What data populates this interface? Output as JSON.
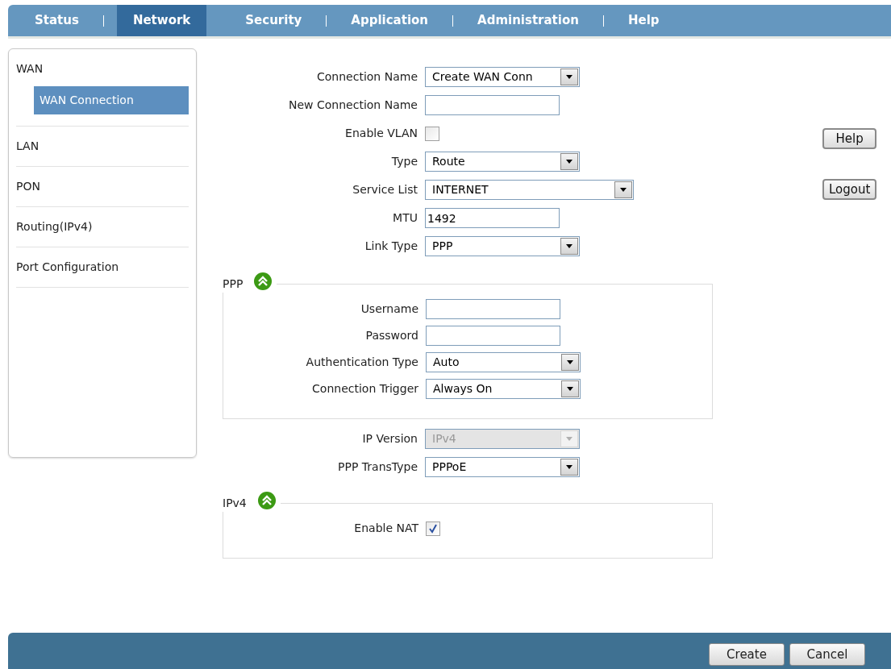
{
  "nav": {
    "tabs": [
      {
        "label": "Status",
        "selected": false
      },
      {
        "label": "Network",
        "selected": true
      },
      {
        "label": "Security",
        "selected": false
      },
      {
        "label": "Application",
        "selected": false
      },
      {
        "label": "Administration",
        "selected": false
      },
      {
        "label": "Help",
        "selected": false
      }
    ]
  },
  "sidebar": {
    "items": [
      {
        "label": "WAN",
        "selected": false,
        "children": [
          {
            "label": "WAN Connection",
            "selected": true
          }
        ]
      },
      {
        "label": "LAN",
        "selected": false
      },
      {
        "label": "PON",
        "selected": false
      },
      {
        "label": "Routing(IPv4)",
        "selected": false
      },
      {
        "label": "Port Configuration",
        "selected": false
      }
    ]
  },
  "form": {
    "items": [
      {
        "kind": "select",
        "label": "Connection Name",
        "value": "Create WAN Conn",
        "disabled": false
      },
      {
        "kind": "text",
        "label": "New Connection Name"
      },
      {
        "kind": "checkbox",
        "label": "Enable VLAN",
        "checked": false
      },
      {
        "kind": "select",
        "label": "Type",
        "value": "Route",
        "disabled": false
      },
      {
        "kind": "select",
        "label": "Service List",
        "value": "INTERNET",
        "disabled": false
      },
      {
        "kind": "text",
        "label": "MTU",
        "value": "1492"
      },
      {
        "kind": "select",
        "label": "Link Type",
        "value": "PPP",
        "disabled": false
      },
      {
        "kind": "section",
        "title": "PPP",
        "expanded": true,
        "fields": [
          {
            "kind": "text",
            "label": "Username"
          },
          {
            "kind": "text",
            "label": "Password"
          },
          {
            "kind": "select",
            "label": "Authentication Type",
            "value": "Auto",
            "disabled": false
          },
          {
            "kind": "select",
            "label": "Connection Trigger",
            "value": "Always On",
            "disabled": false
          }
        ]
      },
      {
        "kind": "select",
        "label": "IP Version",
        "value": "IPv4",
        "disabled": true
      },
      {
        "kind": "select",
        "label": "PPP TransType",
        "value": "PPPoE",
        "disabled": false
      },
      {
        "kind": "section",
        "title": "IPv4",
        "expanded": true,
        "fields": [
          {
            "kind": "checkbox",
            "label": "Enable NAT",
            "checked": true
          }
        ]
      }
    ]
  },
  "side_buttons": [
    "Help",
    "Logout"
  ],
  "footer": {
    "buttons": [
      "Create",
      "Cancel"
    ]
  }
}
